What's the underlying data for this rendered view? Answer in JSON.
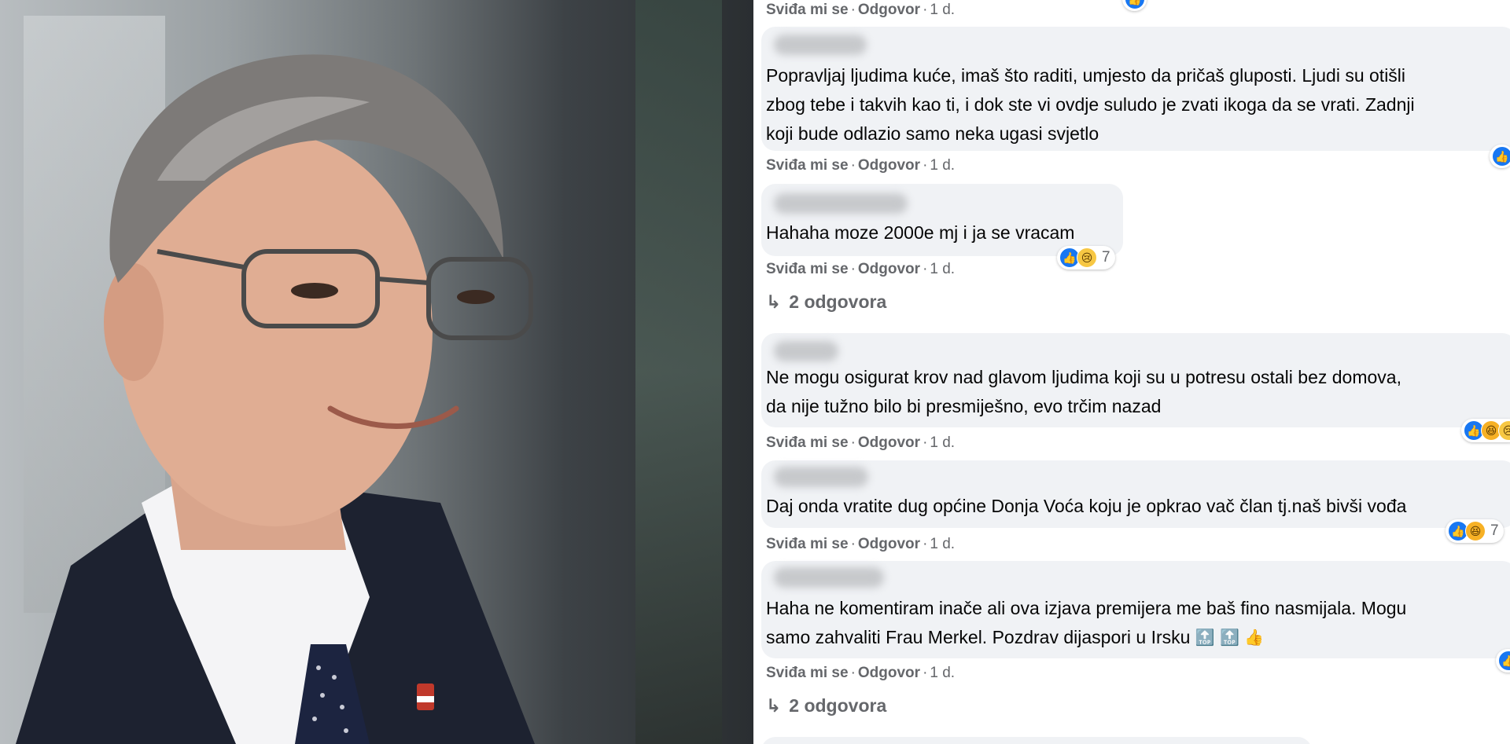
{
  "photo": {
    "alt_name": "portrait-photo"
  },
  "comments": [
    {
      "id": "c0",
      "text_lines": [],
      "actions": {
        "like": "Sviđa mi se",
        "reply": "Odgovor",
        "time": "1 d."
      }
    },
    {
      "id": "c1",
      "text_lines": [
        "Popravljaj ljudima kuće, imaš što raditi, umjesto da pričaš gluposti. Ljudi su otišli",
        "zbog tebe i takvih kao ti, i dok ste vi ovdje suludo je zvati ikoga da se vrati. Zadnji",
        "koji bude odlazio samo neka ugasi svjetlo"
      ],
      "actions": {
        "like": "Sviđa mi se",
        "reply": "Odgovor",
        "time": "1 d."
      }
    },
    {
      "id": "c2",
      "text_lines": [
        "Hahaha moze 2000e mj i ja se vracam"
      ],
      "reaction_count": "7",
      "actions": {
        "like": "Sviđa mi se",
        "reply": "Odgovor",
        "time": "1 d."
      },
      "replies": "2 odgovora"
    },
    {
      "id": "c3",
      "text_lines": [
        "Ne mogu osigurat krov nad glavom ljudima koji su u potresu ostali bez domova,",
        "da nije tužno bilo bi presmiješno, evo trčim nazad"
      ],
      "actions": {
        "like": "Sviđa mi se",
        "reply": "Odgovor",
        "time": "1 d."
      }
    },
    {
      "id": "c4",
      "text_lines": [
        "Daj onda vratite dug općine Donja Voća koju je opkrao vač član tj.naš bivši vođa"
      ],
      "reaction_count": "7",
      "actions": {
        "like": "Sviđa mi se",
        "reply": "Odgovor",
        "time": "1 d."
      }
    },
    {
      "id": "c5",
      "text_lines": [
        "Haha ne komentiram inače ali ova izjava premijera me baš fino nasmijala. Mogu",
        "samo zahvaliti Frau Merkel. Pozdrav dijaspori u Irsku"
      ],
      "actions": {
        "like": "Sviđa mi se",
        "reply": "Odgovor",
        "time": "1 d."
      },
      "replies": "2 odgovora"
    }
  ],
  "icons": {
    "reply_arrow": "↳",
    "like": "👍",
    "sad": "😢",
    "haha": "😆",
    "top": "🔝",
    "thumbs": "👍"
  },
  "colors": {
    "bubble_bg": "#f0f2f5",
    "meta_text": "#65676b",
    "like_blue": "#1877f2"
  }
}
